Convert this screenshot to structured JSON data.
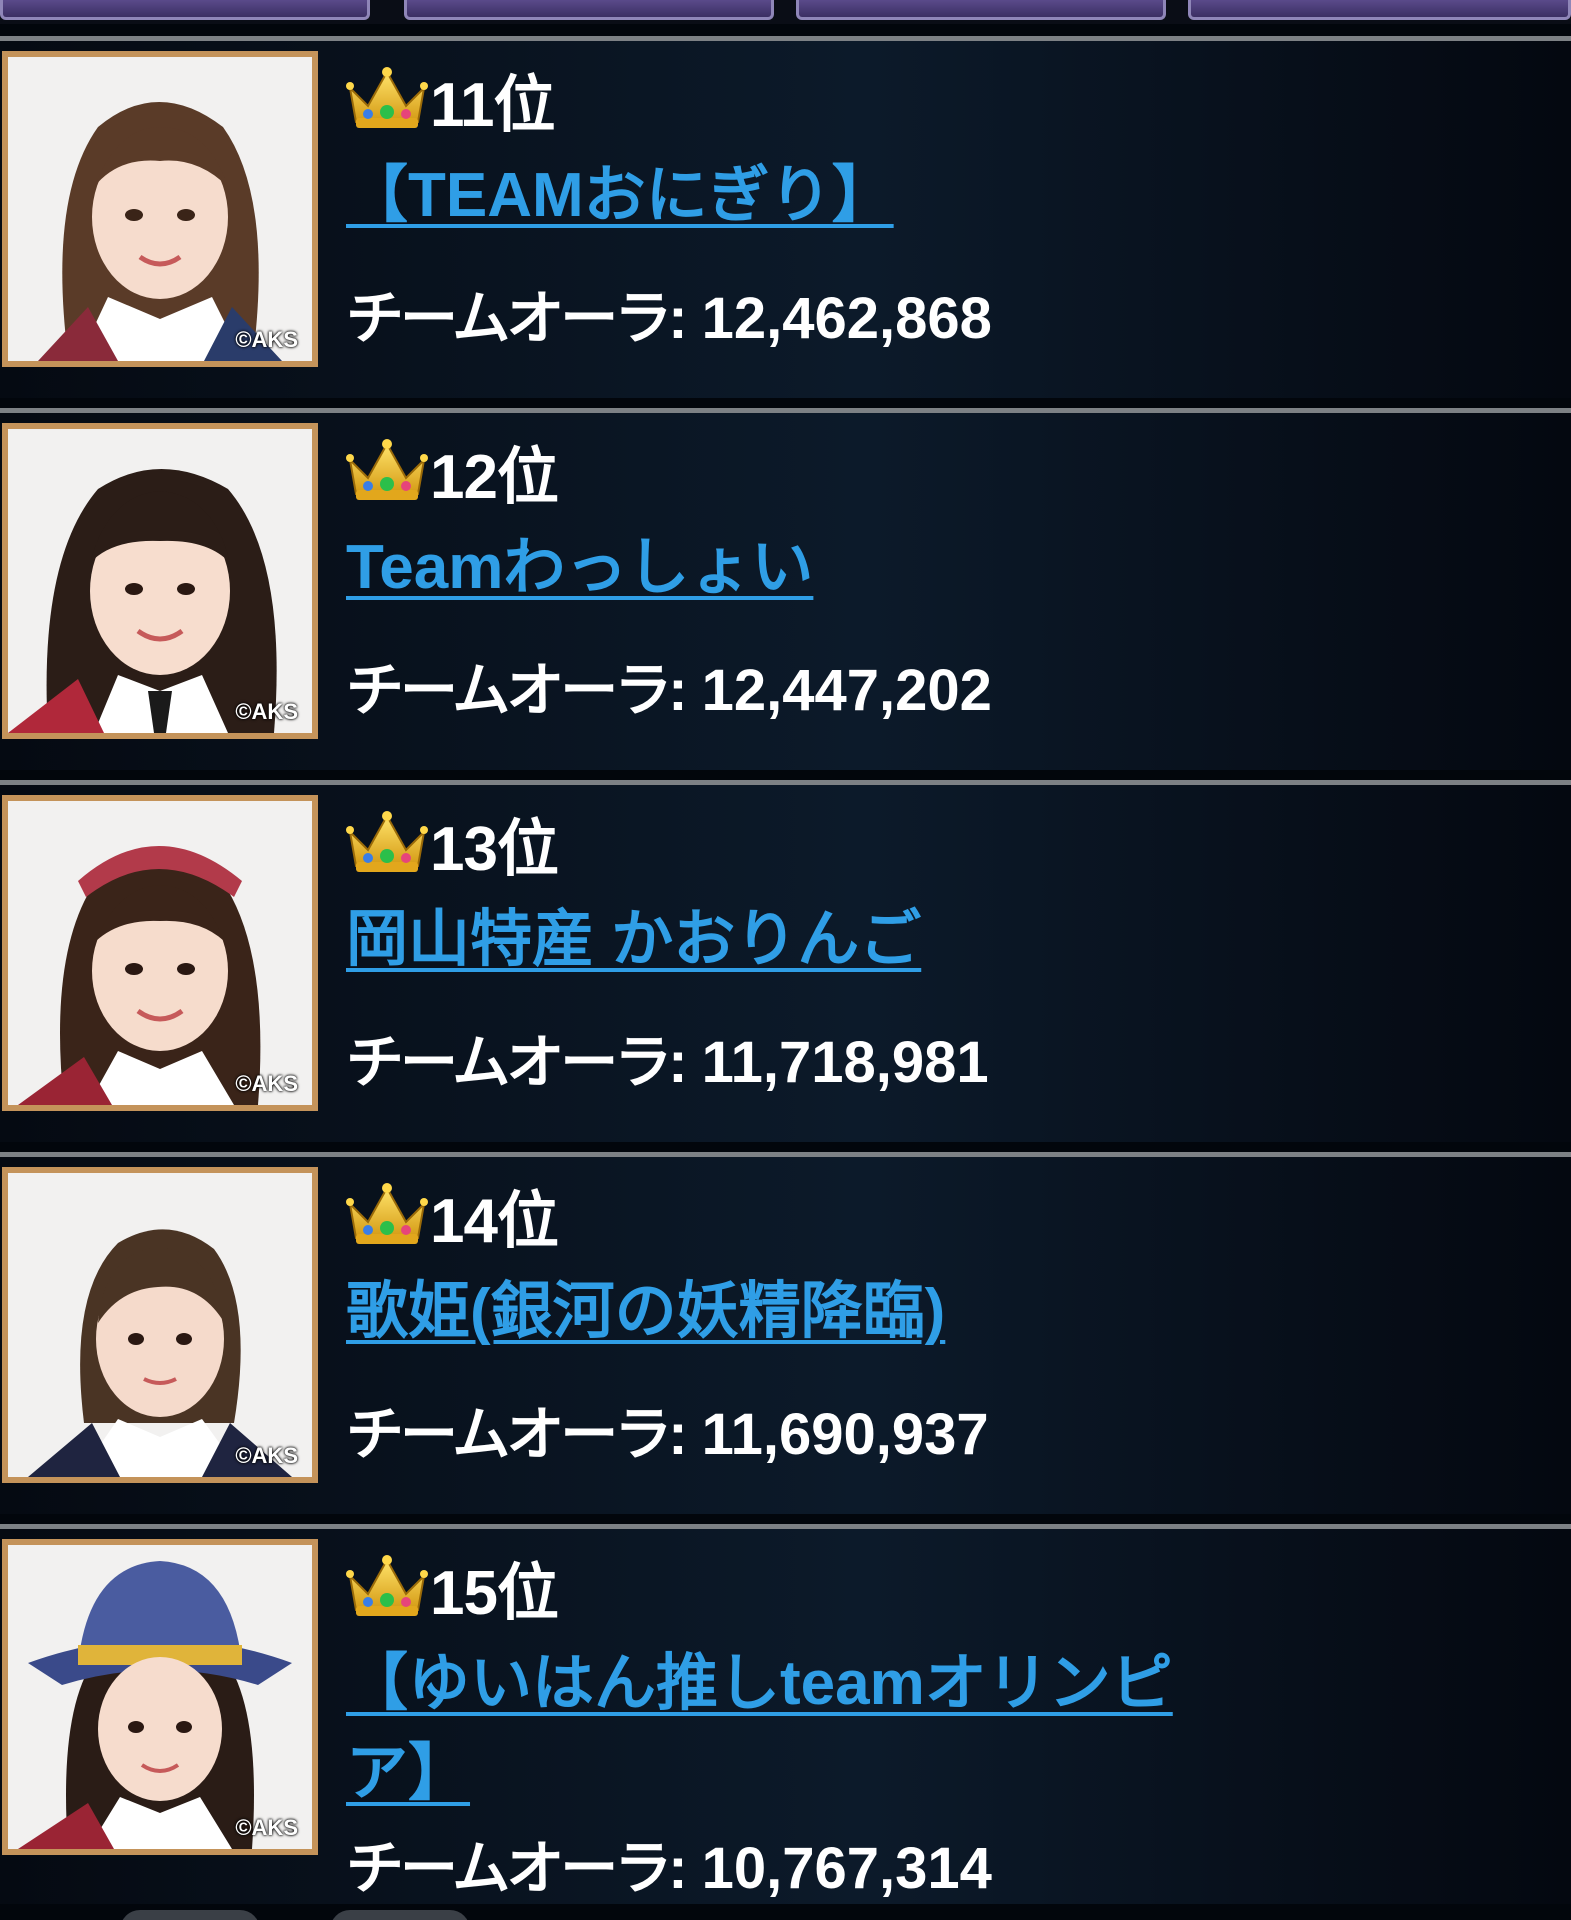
{
  "ranking": [
    {
      "rank": "11位",
      "team_name": "【TEAMおにぎり】",
      "aura_label": "チームオーラ:",
      "aura_value": "12,462,868",
      "copyright": "©AKS",
      "avatar_hair": "#5a3b28"
    },
    {
      "rank": "12位",
      "team_name": "Teamわっしょい",
      "aura_label": "チームオーラ:",
      "aura_value": "12,447,202",
      "copyright": "©AKS",
      "avatar_hair": "#2b1d17"
    },
    {
      "rank": "13位",
      "team_name": "岡山特産 かおりんご",
      "aura_label": "チームオーラ:",
      "aura_value": "11,718,981",
      "copyright": "©AKS",
      "avatar_hair": "#3a2419"
    },
    {
      "rank": "14位",
      "team_name": "歌姫(銀河の妖精降臨)",
      "aura_label": "チームオーラ:",
      "aura_value": "11,690,937",
      "copyright": "©AKS",
      "avatar_hair": "#4a3424"
    },
    {
      "rank": "15位",
      "team_name": "【ゆいはん推しteamオリンピア】",
      "aura_label": "チームオーラ:",
      "aura_value": "10,767,314",
      "copyright": "©AKS",
      "avatar_hair": "#2a1c16"
    }
  ],
  "colors": {
    "link": "#2f9ee6",
    "frame": "#c4935a",
    "divider": "#7d8185"
  },
  "icons": {
    "crown": "crown-icon"
  }
}
